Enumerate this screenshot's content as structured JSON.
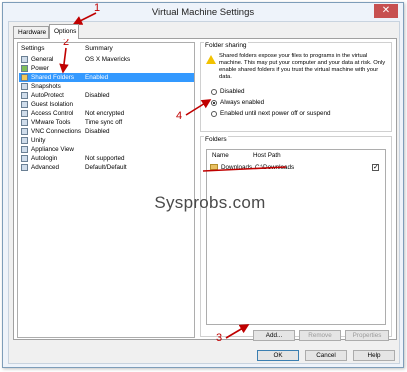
{
  "window": {
    "title": "Virtual Machine Settings",
    "close_glyph": "✕"
  },
  "tabs": [
    {
      "label": "Hardware"
    },
    {
      "label": "Options"
    }
  ],
  "settings": {
    "col_settings": "Settings",
    "col_summary": "Summary",
    "items": [
      {
        "label": "General",
        "summary": "OS X Mavericks",
        "icon": "general-icon"
      },
      {
        "label": "Power",
        "summary": "",
        "icon": "power-icon"
      },
      {
        "label": "Shared Folders",
        "summary": "Enabled",
        "icon": "shared-folders-icon"
      },
      {
        "label": "Snapshots",
        "summary": "",
        "icon": "snapshots-icon"
      },
      {
        "label": "AutoProtect",
        "summary": "Disabled",
        "icon": "autoprotect-icon"
      },
      {
        "label": "Guest Isolation",
        "summary": "",
        "icon": "guest-isolation-icon"
      },
      {
        "label": "Access Control",
        "summary": "Not encrypted",
        "icon": "access-control-icon"
      },
      {
        "label": "VMware Tools",
        "summary": "Time sync off",
        "icon": "vmware-tools-icon"
      },
      {
        "label": "VNC Connections",
        "summary": "Disabled",
        "icon": "vnc-icon"
      },
      {
        "label": "Unity",
        "summary": "",
        "icon": "unity-icon"
      },
      {
        "label": "Appliance View",
        "summary": "",
        "icon": "appliance-view-icon"
      },
      {
        "label": "Autologin",
        "summary": "Not supported",
        "icon": "autologin-icon"
      },
      {
        "label": "Advanced",
        "summary": "Default/Default",
        "icon": "advanced-icon"
      }
    ]
  },
  "folder_sharing": {
    "title": "Folder sharing",
    "warning": "Shared folders expose your files to programs in the virtual machine. This may put your computer and your data at risk. Only enable shared folders if you trust the virtual machine with your data.",
    "options": [
      {
        "label": "Disabled",
        "selected": false
      },
      {
        "label": "Always enabled",
        "selected": true
      },
      {
        "label": "Enabled until next power off or suspend",
        "selected": false
      }
    ]
  },
  "folders": {
    "title": "Folders",
    "col_name": "Name",
    "col_host_path": "Host Path",
    "rows": [
      {
        "name": "Downloads",
        "host_path": "C:\\Downloads",
        "checked": true
      }
    ],
    "buttons": {
      "add": "Add...",
      "remove": "Remove",
      "properties": "Properties"
    }
  },
  "footer": {
    "ok": "OK",
    "cancel": "Cancel",
    "help": "Help"
  },
  "watermark": "Sysprobs.com",
  "annotations": {
    "a1": "1",
    "a2": "2",
    "a3": "3",
    "a4": "4",
    "color": "#c00000"
  }
}
